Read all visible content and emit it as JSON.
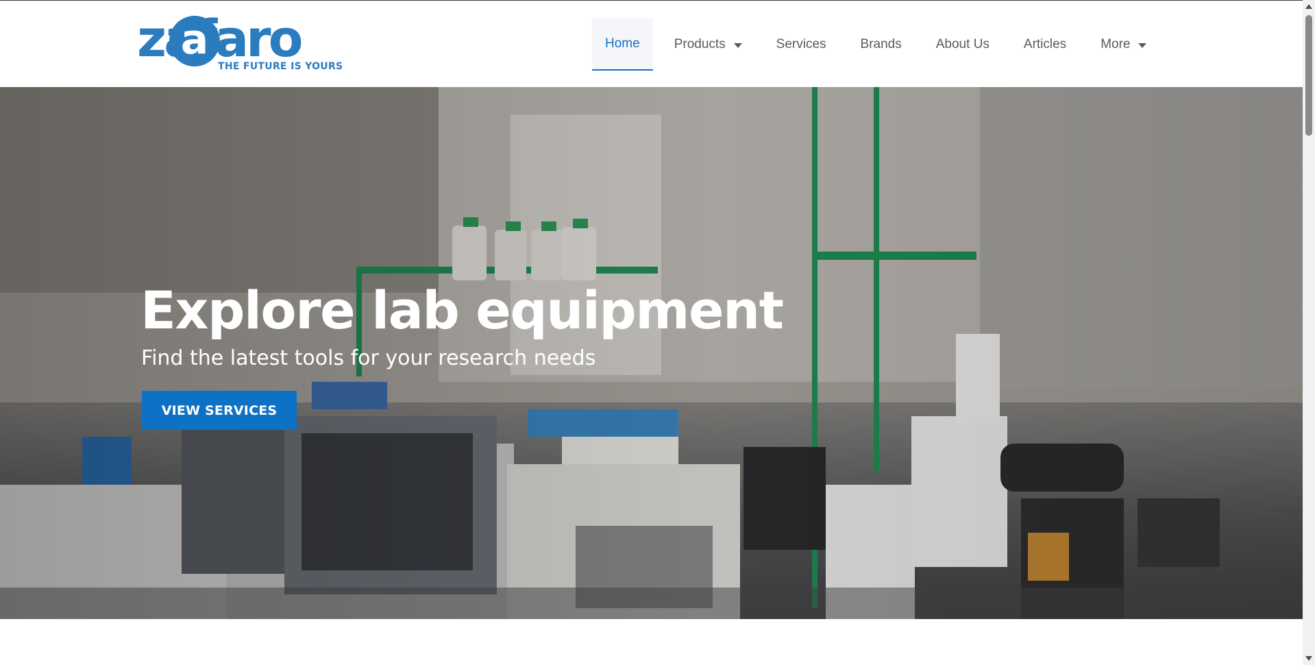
{
  "brand": {
    "logo_text": "zafaro",
    "logo_letter_a": "a",
    "tagline": "THE FUTURE IS YOURS",
    "color": "#2b7bbf"
  },
  "nav": {
    "items": [
      {
        "label": "Home",
        "active": true
      },
      {
        "label": "Products",
        "dropdown": true
      },
      {
        "label": "Services"
      },
      {
        "label": "Brands"
      },
      {
        "label": "About Us"
      },
      {
        "label": "Articles"
      },
      {
        "label": "More",
        "dropdown": true
      }
    ],
    "active_color": "#1b6ec9"
  },
  "hero": {
    "title": "Explore lab equipment",
    "subtitle": "Find the latest tools for your research needs",
    "button_label": "VIEW SERVICES",
    "button_color": "#0d72c6",
    "background_image": "laboratory-bench-photo"
  },
  "icons": [
    "chevron-down-icon",
    "scroll-up-arrow-icon",
    "scroll-down-arrow-icon"
  ]
}
